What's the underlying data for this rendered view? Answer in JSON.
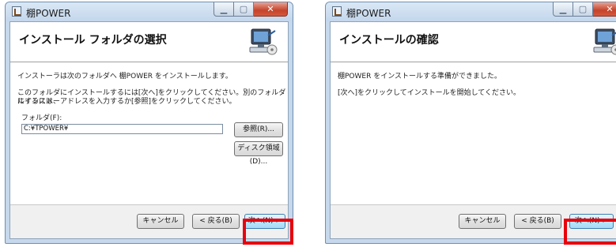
{
  "window1": {
    "title": "棚POWER",
    "heading": "インストール フォルダの選択",
    "intro": "インストーラは次のフォルダへ 棚POWER をインストールします。",
    "instructions_line1": "このフォルダにインストールするには[次へ]をクリックしてください。別のフォルダにインストー",
    "instructions_line2": "ルするには、アドレスを入力するか[参照]をクリックしてください。",
    "folder_label": "フォルダ(F):",
    "folder_value": "C:¥TPOWER¥",
    "browse_button": "参照(R)...",
    "disk_button": "ディスク領域(D)...",
    "cancel_button": "キャンセル",
    "back_button": "< 戻る(B)",
    "next_button": "次へ(N) >"
  },
  "window2": {
    "title": "棚POWER",
    "heading": "インストールの確認",
    "line1": "棚POWER をインストールする準備ができました。",
    "line2": "[次へ]をクリックしてインストールを開始してください。",
    "cancel_button": "キャンセル",
    "back_button": "< 戻る(B)",
    "next_button": "次へ(N) >"
  },
  "colors": {
    "highlight": "#e8000c",
    "frame": "#c5d8ec",
    "close_button": "#c5432b"
  }
}
